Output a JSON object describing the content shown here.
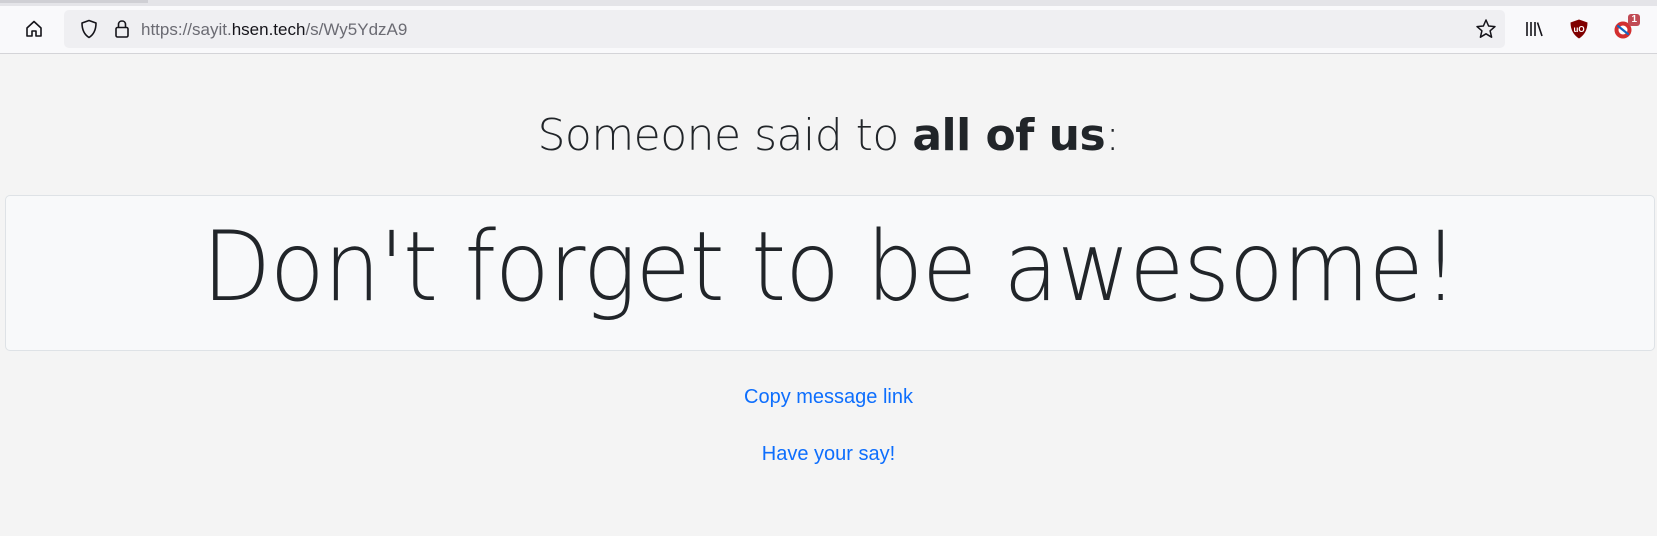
{
  "browser": {
    "url_prefix": "https://sayit.",
    "url_host": "hsen.tech",
    "url_path": "/s/Wy5YdzA9",
    "extension_badge": "1"
  },
  "page": {
    "headline_prefix": "Someone said to ",
    "headline_recipient": "all of us",
    "headline_suffix": ":",
    "message": "Don't forget to be awesome!",
    "copy_link_label": "Copy message link",
    "have_your_say_label": "Have your say!"
  },
  "colors": {
    "link": "#0d6efd",
    "text": "#212529",
    "card_bg": "#f8f9fa",
    "page_bg": "#f4f4f4"
  }
}
